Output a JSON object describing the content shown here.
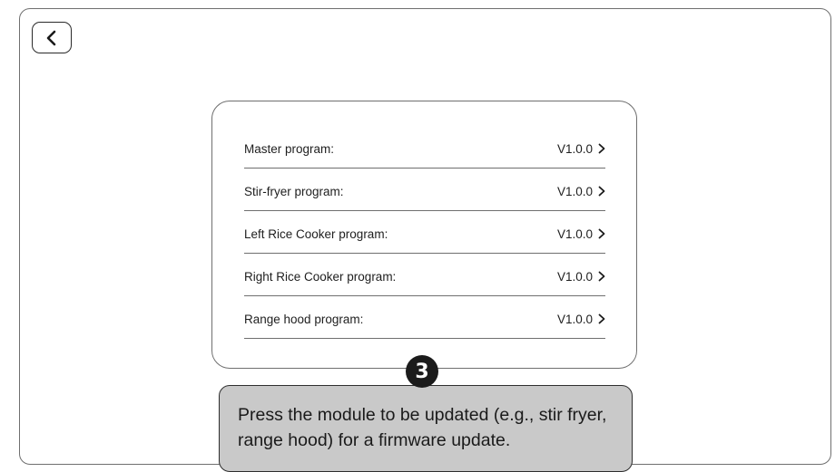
{
  "header": {
    "back_icon": "chevron-left-icon"
  },
  "versions": {
    "rows": [
      {
        "label": "Master program:",
        "value": "V1.0.0"
      },
      {
        "label": "Stir-fryer program:",
        "value": "V1.0.0"
      },
      {
        "label": "Left Rice Cooker program:",
        "value": "V1.0.0"
      },
      {
        "label": "Right Rice Cooker program:",
        "value": "V1.0.0"
      },
      {
        "label": "Range hood program:",
        "value": "V1.0.0"
      }
    ],
    "row_icon": "chevron-right-icon"
  },
  "annotation": {
    "step": "3",
    "text": "Press the module to be updated (e.g., stir fryer, range hood) for a firmware update."
  }
}
